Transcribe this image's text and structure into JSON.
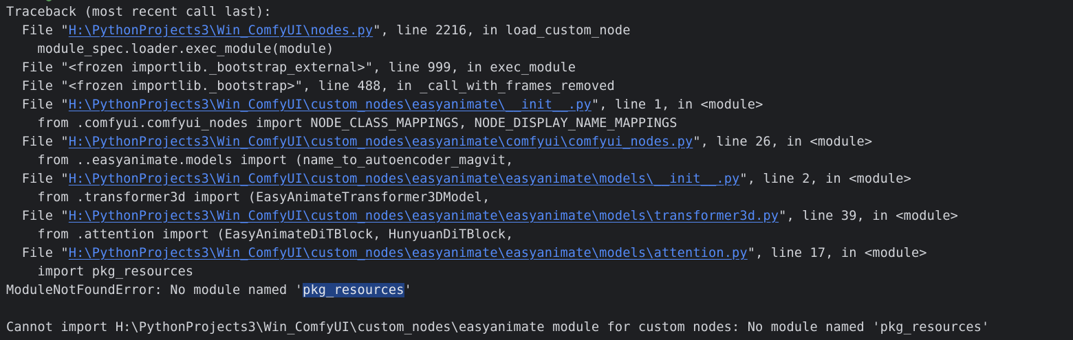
{
  "console": {
    "traceback_header": "Traceback (most recent call last):",
    "frames": [
      {
        "prefix": "  File \"",
        "path": "H:\\PythonProjects3\\Win_ComfyUI\\nodes.py",
        "suffix": "\", line 2216, in load_custom_node",
        "code": "    module_spec.loader.exec_module(module)"
      },
      {
        "prefix": "  File \"<frozen importlib._bootstrap_external>\", line 999, in exec_module"
      },
      {
        "prefix": "  File \"<frozen importlib._bootstrap>\", line 488, in _call_with_frames_removed"
      },
      {
        "prefix": "  File \"",
        "path": "H:\\PythonProjects3\\Win_ComfyUI\\custom_nodes\\easyanimate\\__init__.py",
        "suffix": "\", line 1, in <module>",
        "code": "    from .comfyui.comfyui_nodes import NODE_CLASS_MAPPINGS, NODE_DISPLAY_NAME_MAPPINGS"
      },
      {
        "prefix": "  File \"",
        "path": "H:\\PythonProjects3\\Win_ComfyUI\\custom_nodes\\easyanimate\\comfyui\\comfyui_nodes.py",
        "suffix": "\", line 26, in <module>",
        "code": "    from ..easyanimate.models import (name_to_autoencoder_magvit,"
      },
      {
        "prefix": "  File \"",
        "path": "H:\\PythonProjects3\\Win_ComfyUI\\custom_nodes\\easyanimate\\easyanimate\\models\\__init__.py",
        "suffix": "\", line 2, in <module>",
        "code": "    from .transformer3d import (EasyAnimateTransformer3DModel,"
      },
      {
        "prefix": "  File \"",
        "path": "H:\\PythonProjects3\\Win_ComfyUI\\custom_nodes\\easyanimate\\easyanimate\\models\\transformer3d.py",
        "suffix": "\", line 39, in <module>",
        "code": "    from .attention import (EasyAnimateDiTBlock, HunyuanDiTBlock,"
      },
      {
        "prefix": "  File \"",
        "path": "H:\\PythonProjects3\\Win_ComfyUI\\custom_nodes\\easyanimate\\easyanimate\\models\\attention.py",
        "suffix": "\", line 17, in <module>",
        "code": "    import pkg_resources"
      }
    ],
    "error": {
      "prefix": "ModuleNotFoundError: No module named '",
      "selected": "pkg_resources",
      "suffix": "'"
    },
    "import_failure": "Cannot import H:\\PythonProjects3\\Win_ComfyUI\\custom_nodes\\easyanimate module for custom nodes: No module named 'pkg_resources'"
  },
  "colors": {
    "background": "#1e1f22",
    "text": "#d2d4d9",
    "link": "#548af7",
    "selection": "#214283"
  }
}
